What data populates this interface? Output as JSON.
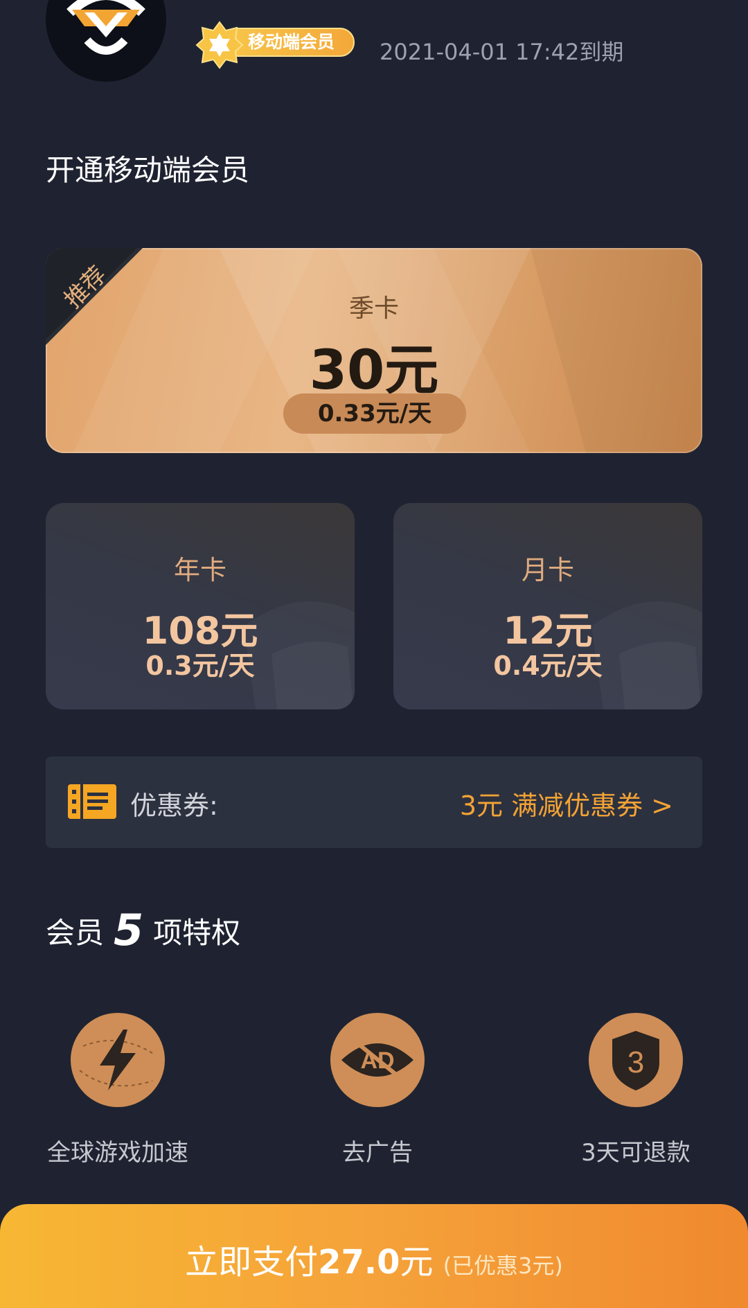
{
  "header": {
    "badge_label": "移动端会员",
    "expiry": "2021-04-01 17:42到期"
  },
  "section_title": "开通移动端会员",
  "plans": {
    "featured": {
      "ribbon": "推荐",
      "name": "季卡",
      "price": "30元",
      "per_day": "0.33元/天"
    },
    "year": {
      "name": "年卡",
      "price": "108元",
      "per_day": "0.3元/天"
    },
    "month": {
      "name": "月卡",
      "price": "12元",
      "per_day": "0.4元/天"
    }
  },
  "coupon": {
    "label": "优惠券:",
    "value": "3元 满减优惠券 >"
  },
  "privileges": {
    "title_prefix": "会员",
    "count": "5",
    "title_suffix": "项特权",
    "items": [
      {
        "label": "全球游戏加速",
        "icon": "lightning-icon"
      },
      {
        "label": "去广告",
        "icon": "no-ad-icon"
      },
      {
        "label": "3天可退款",
        "icon": "shield-3-icon"
      }
    ],
    "shield_number": "3",
    "ad_text": "AD"
  },
  "pay": {
    "prefix": "立即支付",
    "amount": "27.0",
    "unit": "元",
    "note": "(已优惠3元)"
  },
  "colors": {
    "background": "#1f2331",
    "accent": "#f4a334",
    "gold": "#e2a46c"
  }
}
